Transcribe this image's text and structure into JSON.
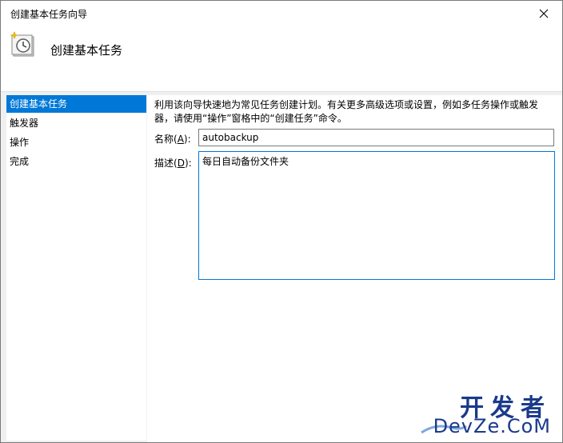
{
  "window": {
    "title": "创建基本任务向导",
    "close_glyph": "✕"
  },
  "header": {
    "icon": "scheduled-task-clock-icon",
    "heading": "创建基本任务"
  },
  "nav": {
    "items": [
      {
        "label": "创建基本任务",
        "selected": true
      },
      {
        "label": "触发器",
        "selected": false
      },
      {
        "label": "操作",
        "selected": false
      },
      {
        "label": "完成",
        "selected": false
      }
    ]
  },
  "content": {
    "intro": "利用该向导快速地为常见任务创建计划。有关更多高级选项或设置，例如多任务操作或触发器，请使用“操作”窗格中的“创建任务”命令。",
    "name_label": "名称",
    "name_accel": "A",
    "name_value": "autobackup",
    "desc_label": "描述",
    "desc_accel": "D",
    "desc_value": "每日自动备份文件夹"
  },
  "watermark": {
    "top": "开发者",
    "bottom": "DevZe.CoM"
  },
  "colors": {
    "selection": "#0078d7",
    "focus_border": "#0078d7",
    "watermark": "#1a3a8a"
  }
}
